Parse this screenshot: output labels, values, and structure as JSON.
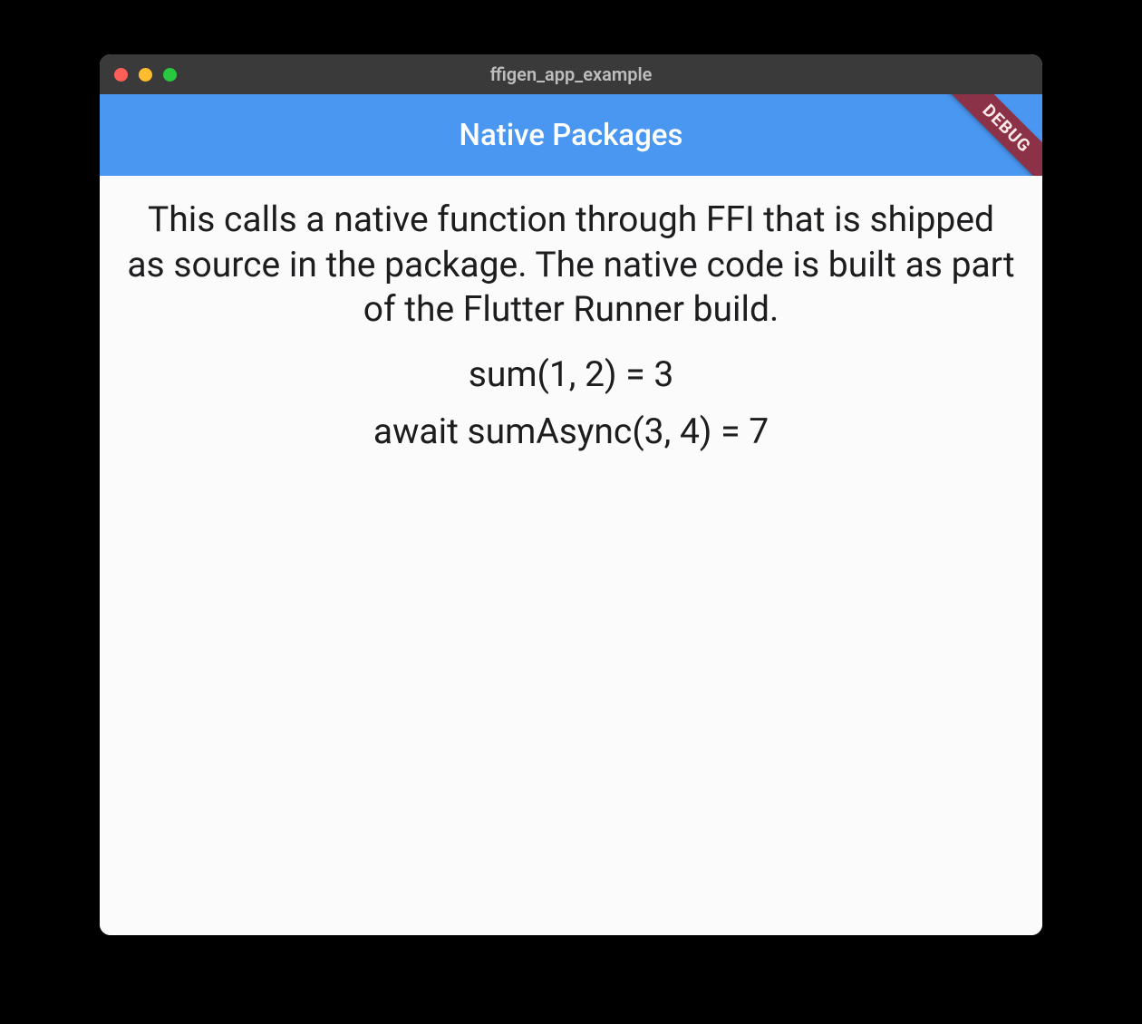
{
  "window": {
    "title": "ffigen_app_example"
  },
  "appbar": {
    "title": "Native Packages"
  },
  "debugBanner": {
    "label": "DEBUG"
  },
  "body": {
    "description": "This calls a native function through FFI that is shipped as source in the package. The native code is built as part of the Flutter Runner build.",
    "sumResult": "sum(1, 2) = 3",
    "sumAsyncResult": "await sumAsync(3, 4) = 7"
  },
  "colors": {
    "appBackground": "#fbfbfb",
    "appbarBackground": "#4a97f2",
    "titlebarBackground": "#3a3a3a",
    "debugBannerBackground": "#8b3248",
    "textPrimary": "#1d1d1f",
    "appbarText": "#ffffff"
  }
}
